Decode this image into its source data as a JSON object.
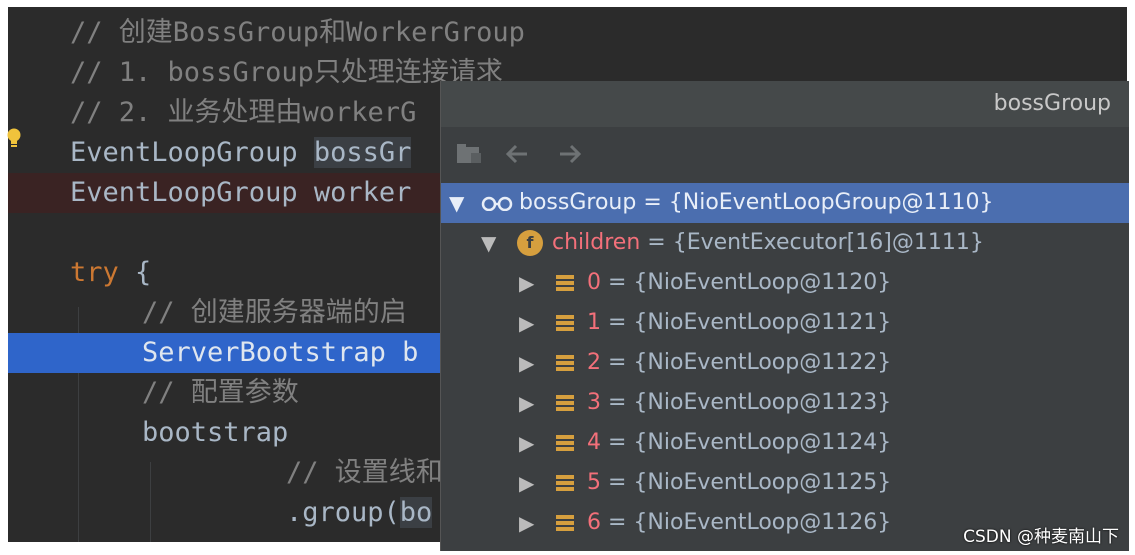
{
  "editor": {
    "lines": [
      {
        "text": "// 创建BossGroup和WorkerGroup"
      },
      {
        "text": "// 1. bossGroup只处理连接请求"
      },
      {
        "text": "// 2. 业务处理由workerG"
      },
      {
        "prefix": "EventLoopGroup ",
        "word": "bossGr"
      },
      {
        "text": "EventLoopGroup worker"
      },
      {
        "keyword": "try",
        "rest": " {"
      },
      {
        "text": "// 创建服务器端的启"
      },
      {
        "text": "ServerBootstrap b"
      },
      {
        "text": "// 配置参数"
      },
      {
        "text": "bootstrap"
      },
      {
        "text": "// 设置线和"
      },
      {
        "prefix": ".group(",
        "word": "bo"
      }
    ]
  },
  "popup": {
    "title": "bossGroup",
    "toolbar": {
      "icons": [
        "folder-icon",
        "back-arrow-icon",
        "forward-arrow-icon"
      ]
    },
    "tree": {
      "root": {
        "name": "bossGroup",
        "value": "{NioEventLoopGroup@1110}",
        "icon": "watch-glasses-icon"
      },
      "children": {
        "name": "children",
        "value": "{EventExecutor[16]@1111}",
        "icon_letter": "f"
      },
      "items": [
        {
          "index": "0",
          "value": "{NioEventLoop@1120}"
        },
        {
          "index": "1",
          "value": "{NioEventLoop@1121}"
        },
        {
          "index": "2",
          "value": "{NioEventLoop@1122}"
        },
        {
          "index": "3",
          "value": "{NioEventLoop@1123}"
        },
        {
          "index": "4",
          "value": "{NioEventLoop@1124}"
        },
        {
          "index": "5",
          "value": "{NioEventLoop@1125}"
        },
        {
          "index": "6",
          "value": "{NioEventLoop@1126}"
        }
      ],
      "eq": " = "
    }
  },
  "watermark": "CSDN @种麦南山下",
  "colors": {
    "accent_selection": "#4b6eaf",
    "editor_bg": "#2b2b2b",
    "field_name_red": "#f3707a"
  }
}
